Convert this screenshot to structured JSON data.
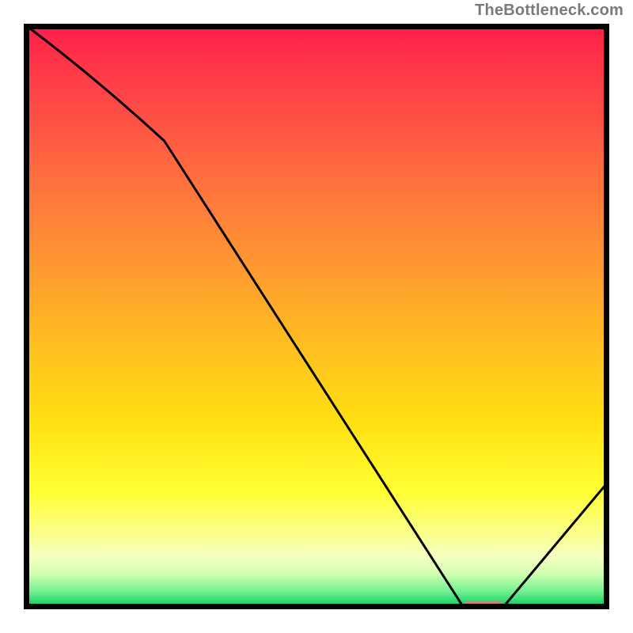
{
  "attribution": "TheBottleneck.com",
  "chart_data": {
    "type": "line",
    "title": "",
    "xlabel": "",
    "ylabel": "",
    "xlim": [
      0,
      100
    ],
    "ylim": [
      0,
      100
    ],
    "x": [
      0,
      24,
      75,
      82,
      100
    ],
    "values": [
      100,
      80,
      0.5,
      0.5,
      22
    ],
    "highlight_band": {
      "x_start": 75,
      "x_end": 82,
      "y": 0.5,
      "color": "#d77a77"
    },
    "gradient_stops": [
      {
        "pos": 0.0,
        "color": "#ff1a4b"
      },
      {
        "pos": 0.5,
        "color": "#ffbf20"
      },
      {
        "pos": 0.8,
        "color": "#ffff33"
      },
      {
        "pos": 1.0,
        "color": "#16c95f"
      }
    ]
  }
}
